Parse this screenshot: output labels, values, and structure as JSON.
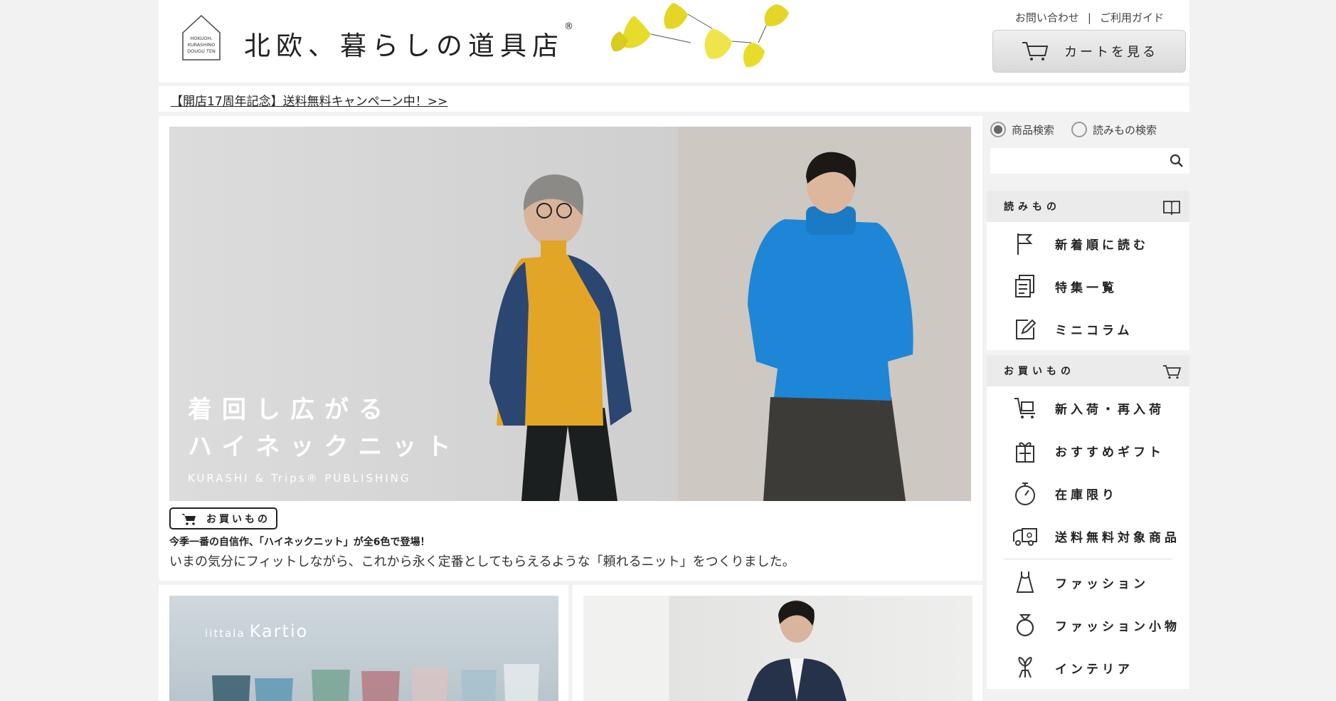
{
  "header": {
    "logo_mark_text": "HOKUOH, KURASHINO DOUGU TEN",
    "site_title": "北欧、暮らしの道具店",
    "site_title_mark": "®",
    "contact_link": "お問い合わせ",
    "separator": "|",
    "guide_link": "ご利用ガイド",
    "cart_button": "カートを見る"
  },
  "notice": {
    "text": "【開店17周年記念】送料無料キャンペーン中！>>"
  },
  "hero": {
    "title_line1": "着回し広がる",
    "title_line2": "ハイネックニット",
    "subtitle": "KURASHI & Trips® PUBLISHING",
    "badge_label": "お買いもの",
    "lead": "今季一番の自信作、「ハイネックニット」が全6色で登場！",
    "description": "いまの気分にフィットしながら、これから永く定番としてもらえるような「頼れるニット」をつくりました。"
  },
  "card2": {
    "brand_small": "iittala",
    "brand": "Kartio"
  },
  "search": {
    "option_products": "商品検索",
    "option_articles": "読みもの検索",
    "selected": "商品検索",
    "placeholder": ""
  },
  "nav": {
    "reading": {
      "heading": "読みもの",
      "items": [
        {
          "label": "新着順に読む",
          "icon": "flag-icon"
        },
        {
          "label": "特集一覧",
          "icon": "documents-icon"
        },
        {
          "label": "ミニコラム",
          "icon": "edit-icon"
        }
      ]
    },
    "shopping": {
      "heading": "お買いもの",
      "items": [
        {
          "label": "新入荷・再入荷",
          "icon": "new-arrival-icon"
        },
        {
          "label": "おすすめギフト",
          "icon": "gift-icon"
        },
        {
          "label": "在庫限り",
          "icon": "stopwatch-icon"
        },
        {
          "label": "送料無料対象商品",
          "icon": "truck-icon"
        },
        {
          "label": "ファッション",
          "icon": "dress-icon"
        },
        {
          "label": "ファッション小物",
          "icon": "ring-icon"
        },
        {
          "label": "インテリア",
          "icon": "plant-icon"
        }
      ]
    }
  },
  "colors": {
    "background": "#f2f2f2",
    "panel": "#ffffff",
    "section_head": "#ebebeb",
    "text": "#222222",
    "knit_yellow": "#e3a526",
    "knit_blue": "#1e86d6",
    "ginkgo_yellow": "#e8dc2a"
  }
}
